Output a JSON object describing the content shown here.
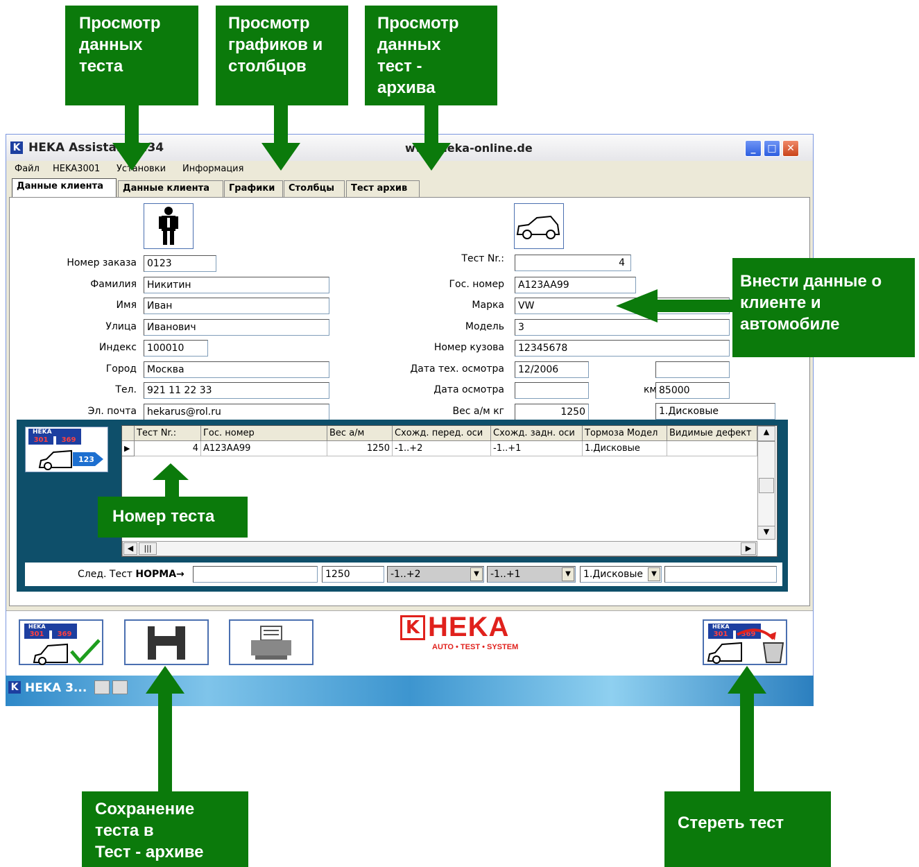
{
  "callouts": {
    "view_test_data": "Просмотр\nданных\nтеста",
    "view_graphs": "Просмотр\nграфиков и\nстолбцов",
    "view_archive": "Просмотр\nданных\nтест -\nархива",
    "enter_data": "Внести данные о\nклиенте и\nавтомобиле",
    "test_number": "Номер  теста",
    "save_test": "Сохранение\nтеста в\nТест - архиве",
    "erase_test": "Стереть тест"
  },
  "window": {
    "logo": "K",
    "title": "HEKA Assistant 3.34",
    "url": "www.heka-online.de",
    "buttons": {
      "minimize": "_",
      "maximize": "□",
      "close": "✕"
    }
  },
  "menu": [
    "Файл",
    "HEKA3001",
    "Установки",
    "Информация"
  ],
  "tabs": [
    "Данные клиента",
    "Данные клиента",
    "Графики",
    "Столбцы",
    "Тест архив"
  ],
  "client": {
    "order_no": {
      "label": "Номер заказа",
      "value": "0123"
    },
    "surname": {
      "label": "Фамилия",
      "value": "Никитин"
    },
    "name": {
      "label": "Имя",
      "value": "Иван"
    },
    "street": {
      "label": "Улица",
      "value": "Иванович"
    },
    "zip": {
      "label": "Индекс",
      "value": "100010"
    },
    "city": {
      "label": "Город",
      "value": "Москва"
    },
    "phone": {
      "label": "Тел.",
      "value": "921 11 22 33"
    },
    "email": {
      "label": "Эл. почта",
      "value": "hekarus@rol.ru"
    }
  },
  "vehicle": {
    "test_no": {
      "label": "Тест Nr.:",
      "value": "4"
    },
    "plate": {
      "label": "Гос. номер",
      "value": "A123AA99"
    },
    "make": {
      "label": "Марка",
      "value": "VW"
    },
    "model": {
      "label": "Модель",
      "value": "3"
    },
    "vin": {
      "label": "Номер кузова",
      "value": "12345678"
    },
    "inspection_date": {
      "label": "Дата тех. осмотра",
      "value": "12/2006"
    },
    "view_date": {
      "label": "Дата осмотра",
      "value": ""
    },
    "km": {
      "label": "км",
      "value": "85000"
    },
    "weight": {
      "label": "Вес а/м кг",
      "value": "1250"
    },
    "brakes": {
      "value": "1.Дисковые"
    }
  },
  "grid": {
    "columns": [
      "Тест Nr.:",
      "Гос. номер",
      "Вес а/м",
      "Схожд. перед. оси",
      "Схожд. задн. оси",
      "Тормоза Модел",
      "Видимые дефект"
    ],
    "rows": [
      [
        "4",
        "A123AA99",
        "1250",
        "-1..+2",
        "-1..+1",
        "1.Дисковые",
        ""
      ]
    ],
    "row_marker": "▶",
    "scroll": {
      "up": "▲",
      "down": "▼",
      "left": "◀",
      "right": "▶",
      "grip": "|||"
    }
  },
  "norm_row": {
    "label_prefix": "След. Тест ",
    "label_bold": "НОРМА",
    "arrow": "→",
    "weight": "1250",
    "front": "-1..+2",
    "rear": "-1..+1",
    "brakes": "1.Дисковые",
    "dd": "▼"
  },
  "icon_banner": {
    "brand": "HEKA",
    "left_num": "301",
    "right_num": "369",
    "steps": "123"
  },
  "logo": {
    "brand": "HEKA",
    "tagline": "AUTO • TEST • SYSTEM"
  },
  "taskbar": {
    "item": "HEKA 3..."
  },
  "colors": {
    "callout_green": "#0b7a0b",
    "panel_teal": "#0e4f6a",
    "brand_red": "#e0211c"
  }
}
